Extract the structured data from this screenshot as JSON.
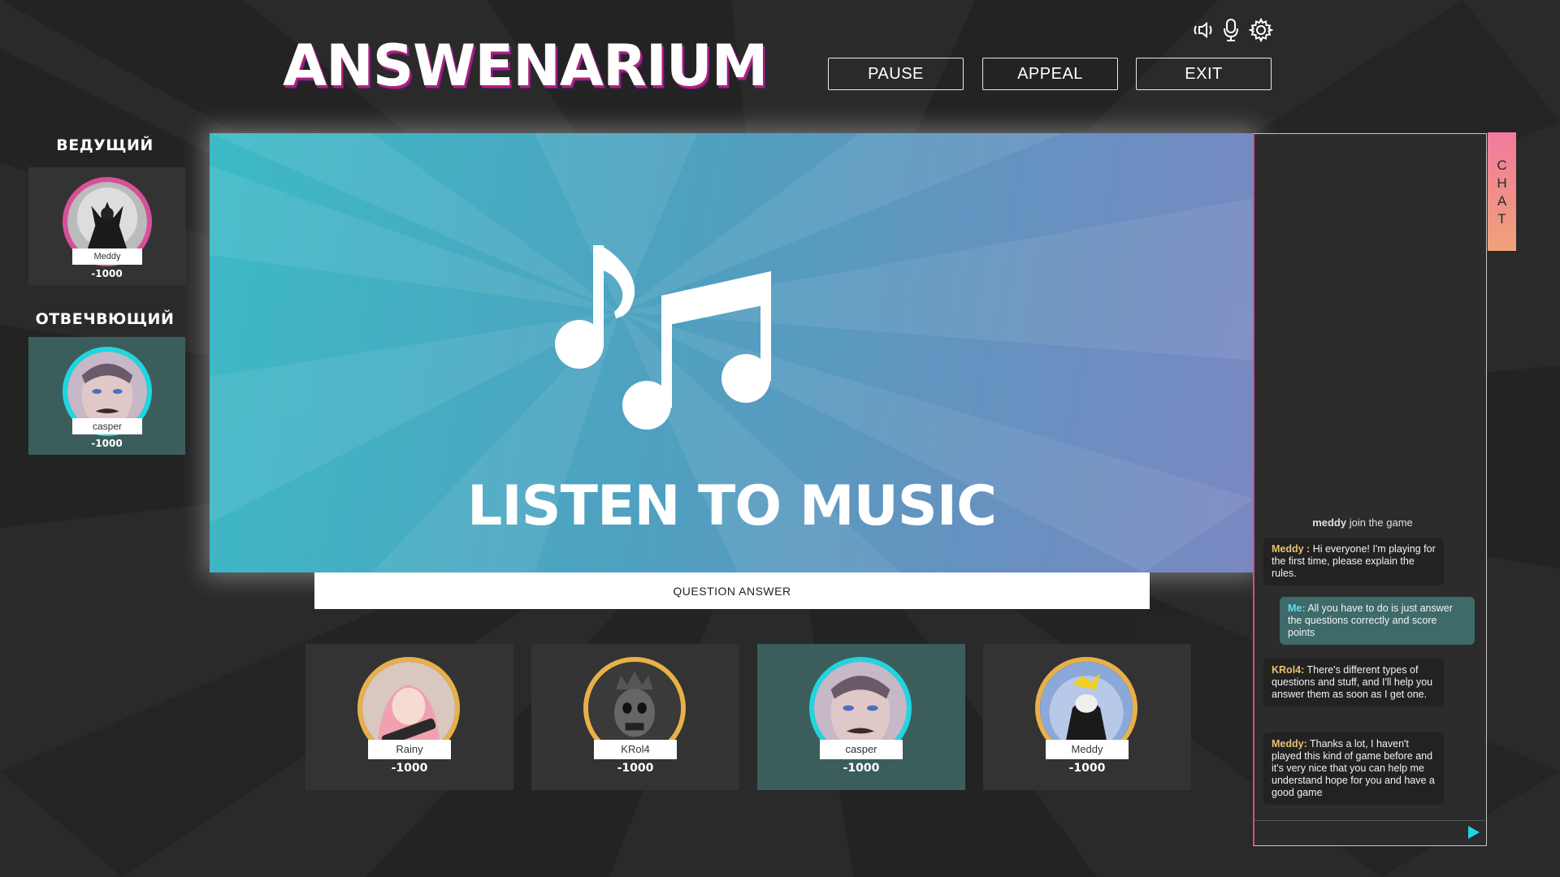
{
  "app": {
    "logo": "ANSWENARIUM"
  },
  "header": {
    "buttons": {
      "pause": "PAUSE",
      "appeal": "APPEAL",
      "exit": "EXIT"
    },
    "icons": [
      "speaker-icon",
      "microphone-icon",
      "gear-icon"
    ]
  },
  "host": {
    "heading": "ВЕДУЩИЙ",
    "name": "Meddy",
    "score": "-1000",
    "ring_color": "#d94f9a"
  },
  "answering": {
    "heading": "ОТВЕЧВЮЩИЙ",
    "name": "casper",
    "score": "-1000",
    "ring_color": "#1fd6e0"
  },
  "main": {
    "icon": "music-notes-icon",
    "title": "LISTEN TO MUSIC",
    "answer_bar": "QUESTION ANSWER"
  },
  "players": [
    {
      "name": "Rainy",
      "score": "-1000",
      "ring_color": "#e8b04a",
      "active": false
    },
    {
      "name": "KRol4",
      "score": "-1000",
      "ring_color": "#e8b04a",
      "active": false
    },
    {
      "name": "casper",
      "score": "-1000",
      "ring_color": "#1fd6e0",
      "active": true
    },
    {
      "name": "Meddy",
      "score": "-1000",
      "ring_color": "#e8b04a",
      "active": false
    }
  ],
  "chat": {
    "tab_label": [
      "C",
      "H",
      "A",
      "T"
    ],
    "system": {
      "user": "meddy",
      "text": " join the game"
    },
    "messages": [
      {
        "author": "Meddy :",
        "text": " Hi everyone! I'm playing for the first time, please explain the rules."
      },
      {
        "author": "Me:",
        "text": " All you have to do is just answer the questions correctly and score points"
      },
      {
        "author": "KRol4:",
        "text": " There's different types of questions and stuff, and I'll help you answer them as soon as I get one."
      },
      {
        "author": "Meddy:",
        "text": " Thanks a lot, I haven't played this kind of game before and it's very nice that you can help me understand hope for you and have a good game"
      }
    ],
    "send_icon": "send-icon"
  },
  "colors": {
    "background": "#2a2a2a",
    "card": "#333333",
    "active_card": "#3b5e5c",
    "accent_cyan": "#1fd6e0",
    "accent_pink": "#d94f9a",
    "accent_gold": "#e8b04a"
  }
}
